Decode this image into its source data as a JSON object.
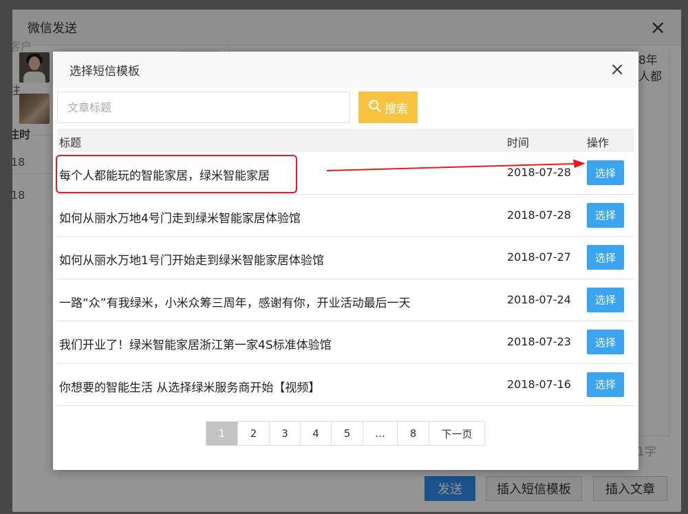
{
  "outer_dialog": {
    "title": "微信发送",
    "close_label": "×",
    "left_partial_texts": [
      "客户",
      "注",
      "注时",
      "18",
      "18"
    ],
    "right_partial_text_line1": "8年",
    "right_partial_text_line2": "人都",
    "char_count_partial": "1字",
    "footer": {
      "send": "发送",
      "insert_sms_template": "插入短信模板",
      "insert_article": "插入文章"
    }
  },
  "modal": {
    "title": "选择短信模板",
    "close_label": "×",
    "search": {
      "placeholder": "文章标题",
      "value": "",
      "button_label": "搜索",
      "button_icon": "search-icon"
    },
    "table": {
      "columns": {
        "title": "标题",
        "time": "时间",
        "action": "操作"
      },
      "rows": [
        {
          "title": "每个人都能玩的智能家居，绿米智能家居",
          "date": "2018-07-28",
          "action": "选择"
        },
        {
          "title": "如何从丽水万地4号门走到绿米智能家居体验馆",
          "date": "2018-07-28",
          "action": "选择"
        },
        {
          "title": "如何从丽水万地1号门开始走到绿米智能家居体验馆",
          "date": "2018-07-27",
          "action": "选择"
        },
        {
          "title": "一路“众”有我绿米，小米众筹三周年，感谢有你，开业活动最后一天",
          "date": "2018-07-24",
          "action": "选择"
        },
        {
          "title": "我们开业了！绿米智能家居浙江第一家4S标准体验馆",
          "date": "2018-07-23",
          "action": "选择"
        },
        {
          "title": "你想要的智能生活 从选择绿米服务商开始【视频】",
          "date": "2018-07-16",
          "action": "选择"
        }
      ]
    },
    "pagination": {
      "pages": [
        "1",
        "2",
        "3",
        "4",
        "5",
        "…",
        "8"
      ],
      "current": "1",
      "next_label": "下一页"
    }
  },
  "colors": {
    "primary_blue": "#2e8ded",
    "select_button": "#3aa4f1",
    "search_button": "#f7c23f",
    "annotation_red": "#f0141b"
  }
}
